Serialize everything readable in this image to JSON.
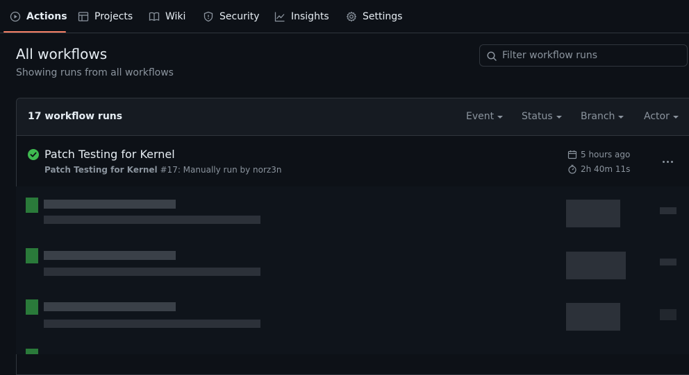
{
  "nav": {
    "tabs": [
      {
        "label": "Actions",
        "icon": "play-icon"
      },
      {
        "label": "Projects",
        "icon": "table-icon"
      },
      {
        "label": "Wiki",
        "icon": "book-icon"
      },
      {
        "label": "Security",
        "icon": "shield-icon"
      },
      {
        "label": "Insights",
        "icon": "graph-icon"
      },
      {
        "label": "Settings",
        "icon": "gear-icon"
      }
    ],
    "active": "Actions"
  },
  "header": {
    "title": "All workflows",
    "subtitle": "Showing runs from all workflows",
    "filter_placeholder": "Filter workflow runs"
  },
  "runs": {
    "count_label": "17 workflow runs",
    "filters": [
      "Event",
      "Status",
      "Branch",
      "Actor"
    ],
    "items": [
      {
        "title": "Patch Testing for Kernel",
        "workflow": "Patch Testing for Kernel",
        "detail": " #17: Manually run by norz3n",
        "status": "success",
        "time_ago": "5 hours ago",
        "duration": "2h 40m 11s"
      }
    ]
  },
  "colors": {
    "background": "#0d1117",
    "accent_underline": "#f78166",
    "success": "#3fb950",
    "muted": "#8b949e"
  }
}
